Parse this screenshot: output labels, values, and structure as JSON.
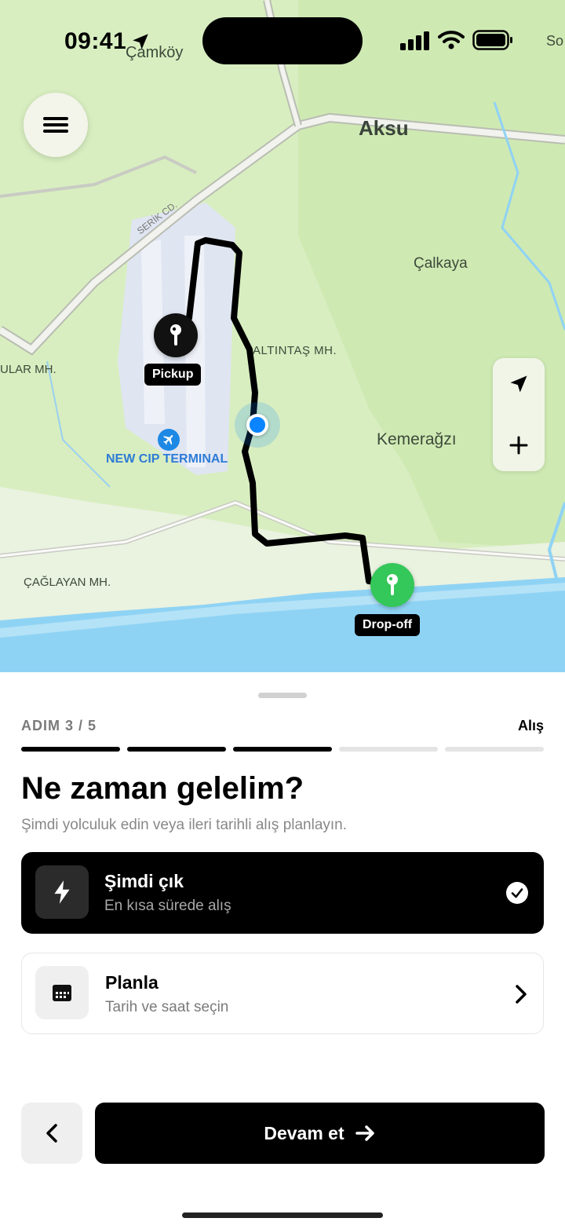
{
  "status_bar": {
    "time": "09:41"
  },
  "map": {
    "labels": {
      "camkoy": "Çamköy",
      "aksu": "Aksu",
      "calkaya": "Çalkaya",
      "altintas": "ALTINTAŞ MH.",
      "ular": "ULAR MH.",
      "kemeragzi": "Kemerağzı",
      "caglayan": "ÇAĞLAYAN MH.",
      "cip": "NEW CIP TERMINAL",
      "serik": "SERİK CD.",
      "so": "So"
    },
    "pickup_label": "Pickup",
    "dropoff_label": "Drop-off"
  },
  "sheet": {
    "step_label": "ADIM 3 / 5",
    "step_name": "Alış",
    "progress": {
      "completed": 3,
      "total": 5
    },
    "title": "Ne zaman gelelim?",
    "subtitle": "Şimdi yolculuk edin veya ileri tarihli alış planlayın.",
    "options": [
      {
        "title": "Şimdi çık",
        "subtitle": "En kısa sürede alış",
        "selected": true,
        "icon": "bolt-icon"
      },
      {
        "title": "Planla",
        "subtitle": "Tarih ve saat seçin",
        "selected": false,
        "icon": "calendar-icon"
      }
    ],
    "continue_label": "Devam et"
  },
  "colors": {
    "accent": "#000000",
    "pickup": "#111111",
    "dropoff": "#34c759",
    "user_location": "#0a84ff",
    "water": "#8fd3f4"
  }
}
